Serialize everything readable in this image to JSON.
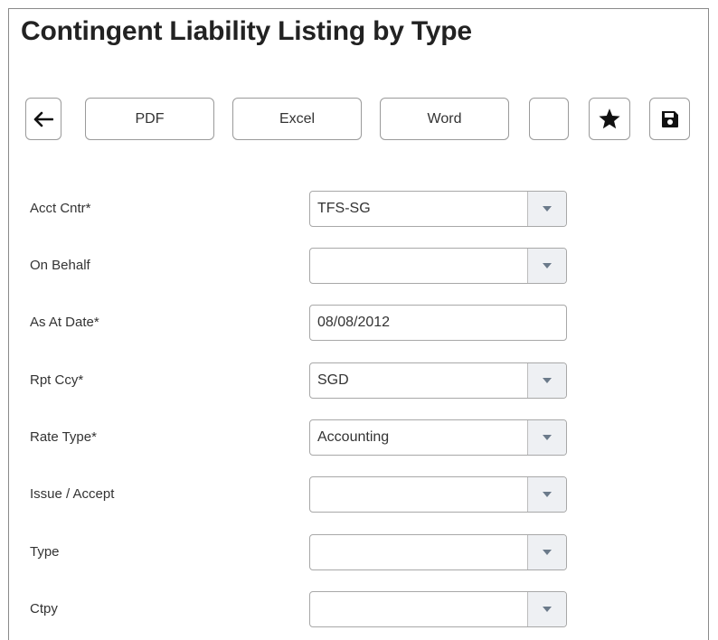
{
  "page": {
    "title": "Contingent Liability Listing by Type"
  },
  "toolbar": {
    "pdf_label": "PDF",
    "excel_label": "Excel",
    "word_label": "Word",
    "back_icon": "arrow-left-icon",
    "favorite_icon": "star-icon",
    "save_icon": "floppy-disk-icon"
  },
  "form": {
    "fields": [
      {
        "label": "Acct Cntr*",
        "value": "TFS-SG",
        "control": "select"
      },
      {
        "label": "On Behalf",
        "value": "",
        "control": "select"
      },
      {
        "label": "As At Date*",
        "value": "08/08/2012",
        "control": "text"
      },
      {
        "label": "Rpt Ccy*",
        "value": "SGD",
        "control": "select"
      },
      {
        "label": "Rate Type*",
        "value": "Accounting",
        "control": "select"
      },
      {
        "label": "Issue / Accept",
        "value": "",
        "control": "select"
      },
      {
        "label": "Type",
        "value": "",
        "control": "select"
      },
      {
        "label": "Ctpy",
        "value": "",
        "control": "select"
      }
    ]
  },
  "colors": {
    "border": "#9a9a9a",
    "arrow_bg": "#eef0f3",
    "text": "#333333"
  }
}
